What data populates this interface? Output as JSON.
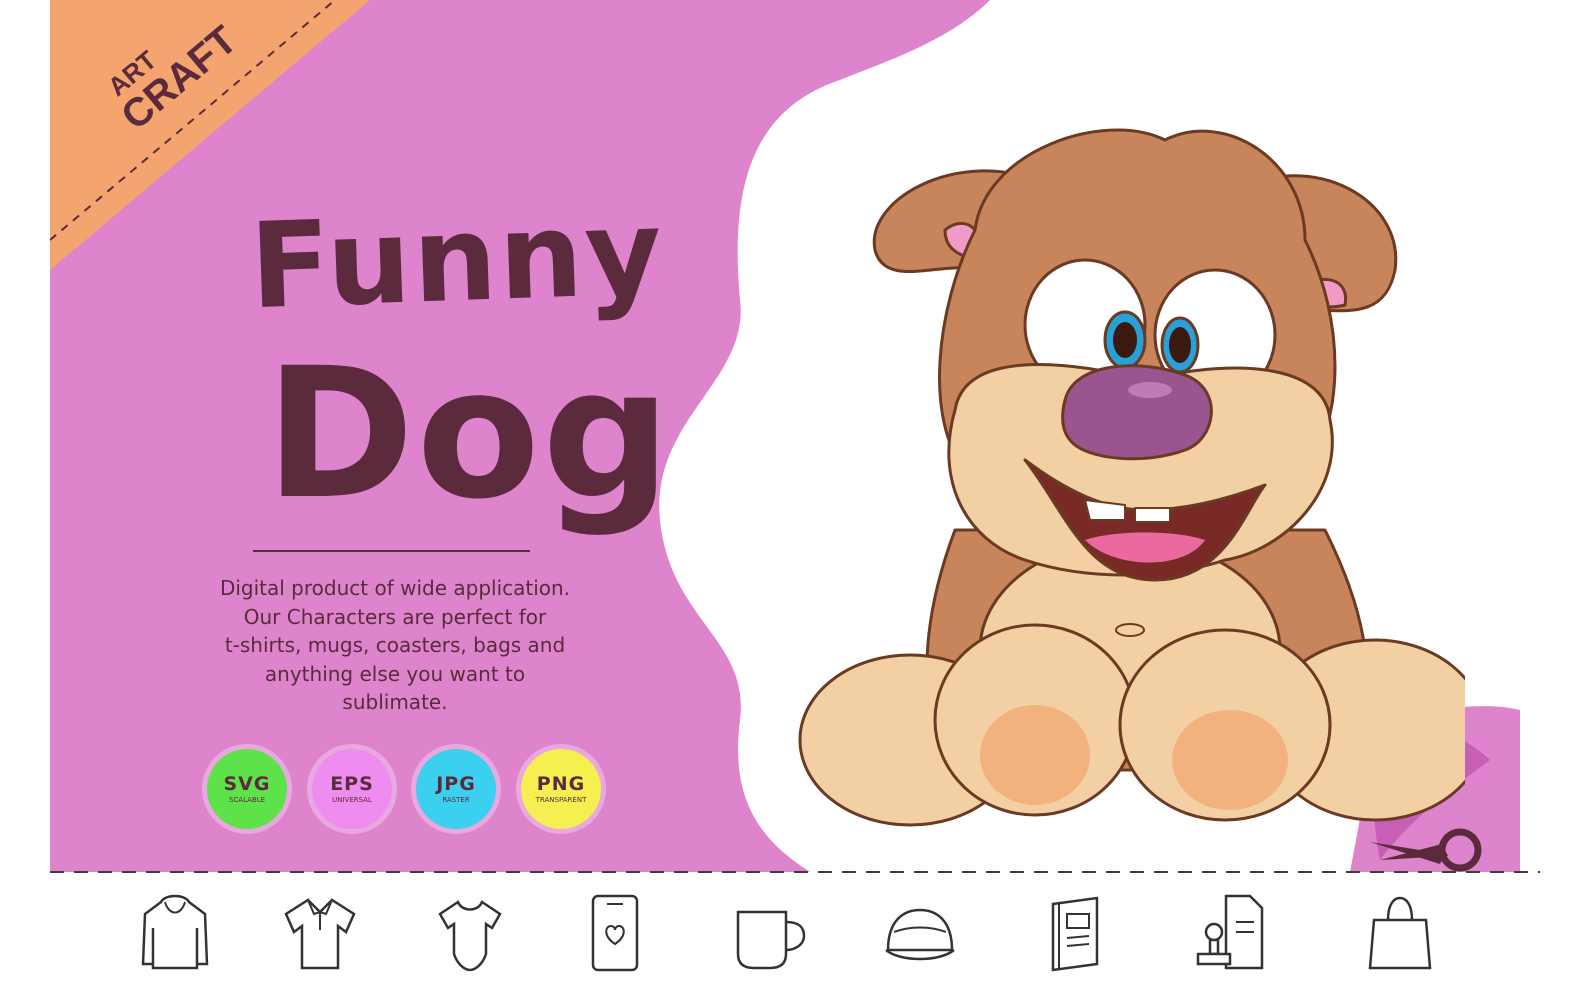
{
  "brand": {
    "line1": "ART",
    "line2": "CRAFT",
    "ribbon_color": "#f4a46e"
  },
  "title": {
    "line1": "Funny",
    "line2": "Dog"
  },
  "description": [
    "Digital product of wide application.",
    "Our Characters are perfect for",
    "t-shirts, mugs, coasters, bags and",
    "anything else you want to",
    "sublimate."
  ],
  "formats": [
    {
      "name": "SVG",
      "sub": "SCALABLE",
      "color": "#5ee24a"
    },
    {
      "name": "EPS",
      "sub": "UNIVERSAL",
      "color": "#ee8cf0"
    },
    {
      "name": "JPG",
      "sub": "RASTER",
      "color": "#3cd0ef"
    },
    {
      "name": "PNG",
      "sub": "TRANSPARENT",
      "color": "#f5f050"
    }
  ],
  "colors": {
    "panel": "#dd84cc",
    "text": "#5b2a3c",
    "fur": "#c8845a",
    "muzzle": "#f3cfa4",
    "nose": "#9a5590"
  },
  "product_icons": [
    "hoodie-icon",
    "polo-shirt-icon",
    "baby-bodysuit-icon",
    "phone-case-icon",
    "mug-icon",
    "cap-icon",
    "notebook-icon",
    "stamp-icon",
    "shopping-bag-icon"
  ]
}
